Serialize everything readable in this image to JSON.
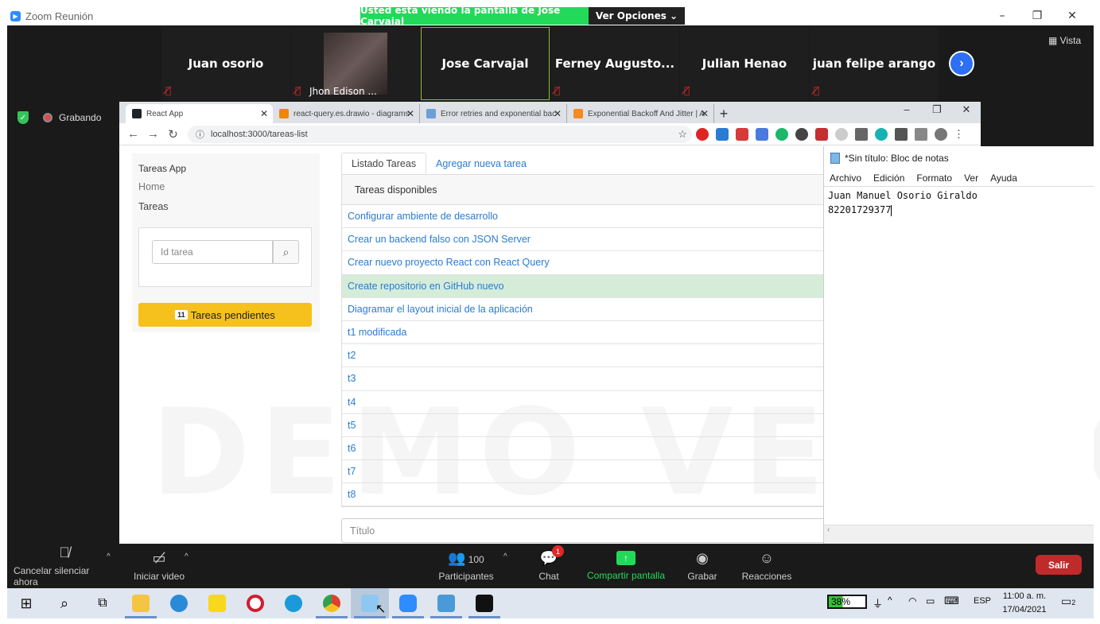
{
  "zoom": {
    "window_title": "Zoom Reunión",
    "share_banner": "Usted está viendo la pantalla de Jose Carvajal",
    "view_options": "Ver Opciones",
    "view_label": "Vista",
    "recording_label": "Grabando",
    "participants": [
      {
        "name": "Juan osorio",
        "muted": true,
        "active": false
      },
      {
        "name": "Jhon Edison ...",
        "muted": true,
        "active": false,
        "video": true
      },
      {
        "name": "Jose Carvajal",
        "muted": false,
        "active": true
      },
      {
        "name": "Ferney  Augusto...",
        "muted": true,
        "active": false
      },
      {
        "name": "Julian Henao",
        "muted": true,
        "active": false
      },
      {
        "name": "juan felipe arango",
        "muted": true,
        "active": false
      }
    ],
    "toolbar": {
      "unmute": "Cancelar silenciar ahora",
      "video": "Iniciar video",
      "participants": "Participantes",
      "participants_count": "100",
      "chat": "Chat",
      "chat_badge": "1",
      "share": "Compartir pantalla",
      "record": "Grabar",
      "reactions": "Reacciones",
      "leave": "Salir"
    }
  },
  "browser": {
    "tabs": [
      {
        "title": "React App",
        "active": true,
        "color": "#20232a"
      },
      {
        "title": "react-query.es.drawio - diagrams",
        "active": false,
        "color": "#f08705"
      },
      {
        "title": "Error retries and exponential bac",
        "active": false,
        "color": "#6a9fd8"
      },
      {
        "title": "Exponential Backoff And Jitter | A",
        "active": false,
        "color": "#f28b22"
      }
    ],
    "url": "localhost:3000/tareas-list"
  },
  "app": {
    "brand": "Tareas App",
    "nav": [
      "Home",
      "Tareas"
    ],
    "search_placeholder": "Id tarea",
    "pending_count": "11",
    "pending_label": "Tareas pendientes",
    "tabs": [
      "Listado Tareas",
      "Agregar nueva tarea"
    ],
    "list_header": "Tareas disponibles",
    "tasks": [
      "Configurar ambiente de desarrollo",
      "Crear un backend falso con JSON Server",
      "Crear nuevo proyecto React con React Query",
      "Create repositorio en GitHub nuevo",
      "Diagramar el layout inicial de la aplicación",
      "t1 modificada",
      "t2",
      "t3",
      "t4",
      "t5",
      "t6",
      "t7",
      "t8"
    ],
    "title_placeholder": "Título",
    "watermark": "DEMO VERSION"
  },
  "notepad": {
    "title": "*Sin título: Bloc de notas",
    "menu": [
      "Archivo",
      "Edición",
      "Formato",
      "Ver",
      "Ayuda"
    ],
    "lines": [
      "Juan Manuel Osorio Giraldo",
      "82201729377"
    ]
  },
  "taskbar": {
    "battery": "38%",
    "lang": "ESP",
    "time": "11:00 a. m.",
    "date": "17/04/2021",
    "notifications": "2"
  }
}
